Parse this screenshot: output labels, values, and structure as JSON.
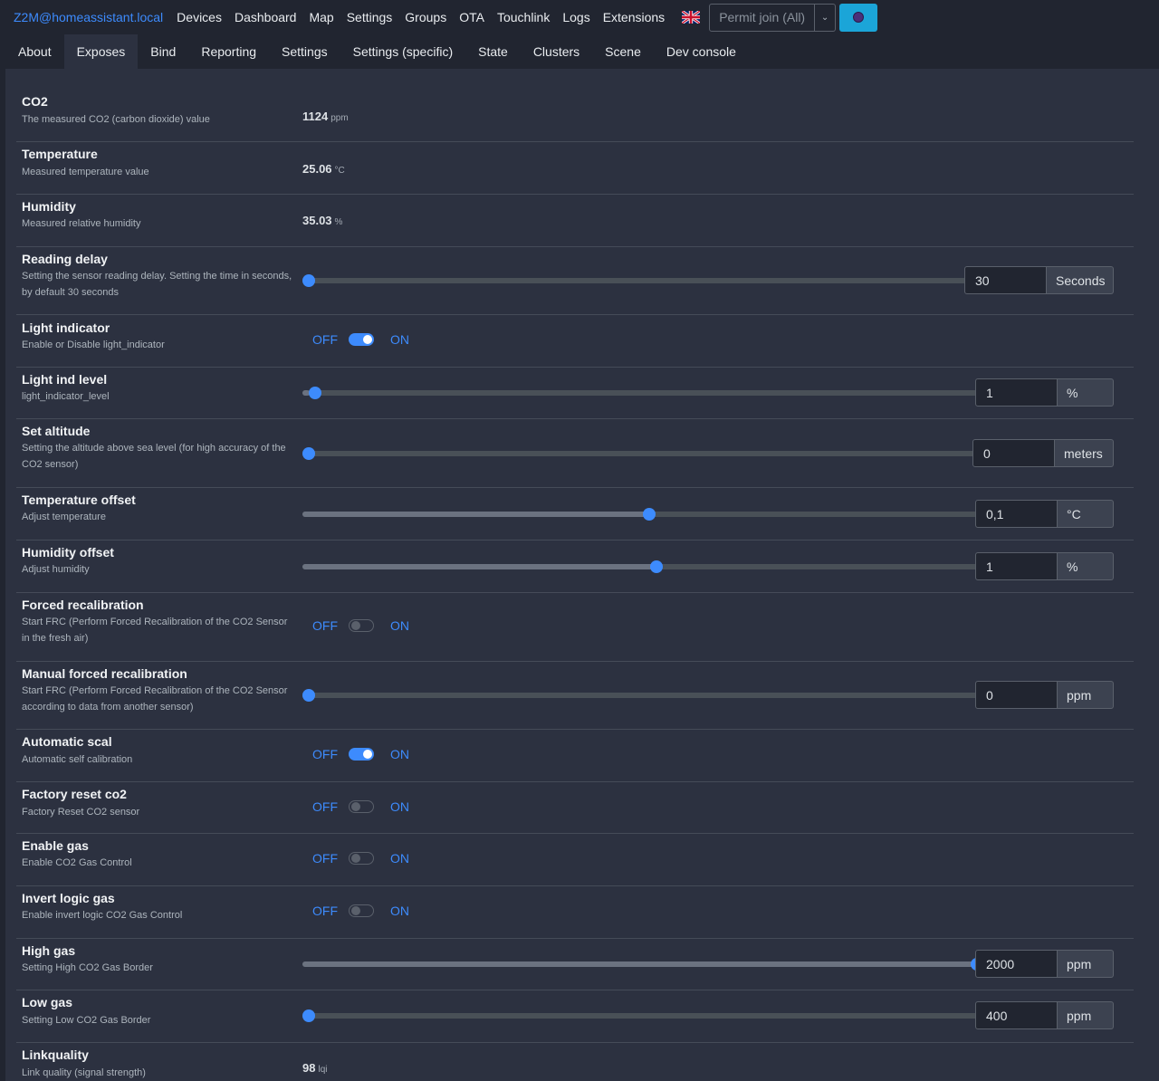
{
  "navbar": {
    "brand": "Z2M@homeassistant.local",
    "links": [
      "Devices",
      "Dashboard",
      "Map",
      "Settings",
      "Groups",
      "OTA",
      "Touchlink",
      "Logs",
      "Extensions"
    ],
    "permit_join": "Permit join (All)",
    "caret_icon": "chevron-down",
    "flag_icon": "uk-flag"
  },
  "tabs": [
    "About",
    "Exposes",
    "Bind",
    "Reporting",
    "Settings",
    "Settings (specific)",
    "State",
    "Clusters",
    "Scene",
    "Dev console"
  ],
  "active_tab": "Exposes",
  "switch_labels": {
    "off": "OFF",
    "on": "ON"
  },
  "rows": [
    {
      "name": "CO2",
      "desc": "The measured CO2 (carbon dioxide) value",
      "value": "1124",
      "unit": "ppm"
    },
    {
      "name": "Temperature",
      "desc": "Measured temperature value",
      "value": "25.06",
      "unit": "°C"
    },
    {
      "name": "Humidity",
      "desc": "Measured relative humidity",
      "value": "35.03",
      "unit": "%"
    },
    {
      "name": "Reading delay",
      "desc": "Setting the sensor reading delay. Setting the time in seconds, by default 30 seconds",
      "input": "30",
      "unit": "Seconds",
      "slider": 0.0
    },
    {
      "name": "Light indicator",
      "desc": "Enable or Disable light_indicator",
      "switch": true
    },
    {
      "name": "Light ind level",
      "desc": "light_indicator_level",
      "input": "1",
      "unit": "%",
      "slider": 0.01
    },
    {
      "name": "Set altitude",
      "desc": "Setting the altitude above sea level (for high accuracy of the CO2 sensor)",
      "input": "0",
      "unit": "meters",
      "slider": 0.0
    },
    {
      "name": "Temperature offset",
      "desc": "Adjust temperature",
      "input": "0,1",
      "unit": "°C",
      "slider": 0.51
    },
    {
      "name": "Humidity offset",
      "desc": "Adjust humidity",
      "input": "1",
      "unit": "%",
      "slider": 0.52
    },
    {
      "name": "Forced recalibration",
      "desc": "Start FRC (Perform Forced Recalibration of the CO2 Sensor in the fresh air)",
      "switch": false
    },
    {
      "name": "Manual forced recalibration",
      "desc": "Start FRC (Perform Forced Recalibration of the CO2 Sensor according to data from another sensor)",
      "input": "0",
      "unit": "ppm",
      "slider": 0.0
    },
    {
      "name": "Automatic scal",
      "desc": "Automatic self calibration",
      "switch": true
    },
    {
      "name": "Factory reset co2",
      "desc": "Factory Reset CO2 sensor",
      "switch": false
    },
    {
      "name": "Enable gas",
      "desc": "Enable CO2 Gas Control",
      "switch": false
    },
    {
      "name": "Invert logic gas",
      "desc": "Enable invert logic CO2 Gas Control",
      "switch": false
    },
    {
      "name": "High gas",
      "desc": "Setting High CO2 Gas Border",
      "input": "2000",
      "unit": "ppm",
      "slider": 1.0
    },
    {
      "name": "Low gas",
      "desc": "Setting Low CO2 Gas Border",
      "input": "400",
      "unit": "ppm",
      "slider": 0.0
    },
    {
      "name": "Linkquality",
      "desc": "Link quality (signal strength)",
      "value": "98",
      "unit": "lqi"
    }
  ]
}
